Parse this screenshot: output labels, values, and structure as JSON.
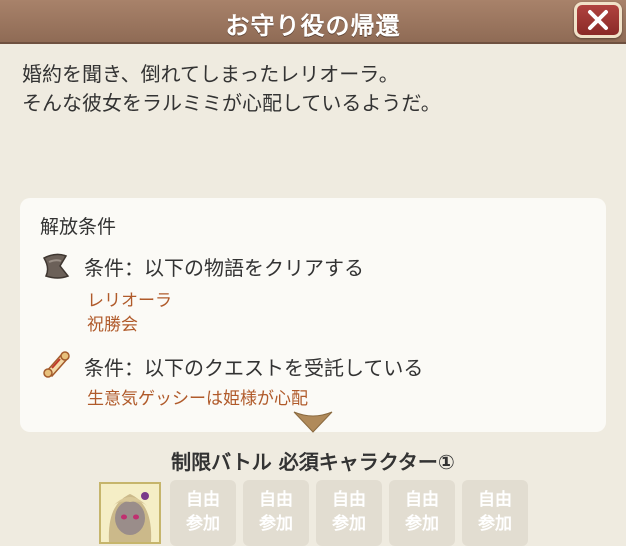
{
  "dialog": {
    "title": "お守り役の帰還",
    "close_icon": "close-icon"
  },
  "description": {
    "line1": "婚約を聞き、倒れてしまったレリオーラ。",
    "line2": "そんな彼女をラルミミが心配しているようだ。"
  },
  "unlock": {
    "heading": "解放条件",
    "conditions": [
      {
        "icon": "story-bookmark-icon",
        "label": "条件：以下の物語をクリアする",
        "items": [
          "レリオーラ",
          "祝勝会"
        ]
      },
      {
        "icon": "quest-scroll-icon",
        "label": "条件：以下のクエストを受託している",
        "items": [
          "生意気ゲッシーは姫様が心配"
        ]
      }
    ]
  },
  "battle": {
    "required_label": "制限バトル 必須キャラクター①",
    "slot_line1": "自由",
    "slot_line2": "参加"
  },
  "colors": {
    "titlebar": "#9a7560",
    "close_button": "#9c3532",
    "condition_item": "#b05a2a",
    "background": "#efebe0"
  }
}
